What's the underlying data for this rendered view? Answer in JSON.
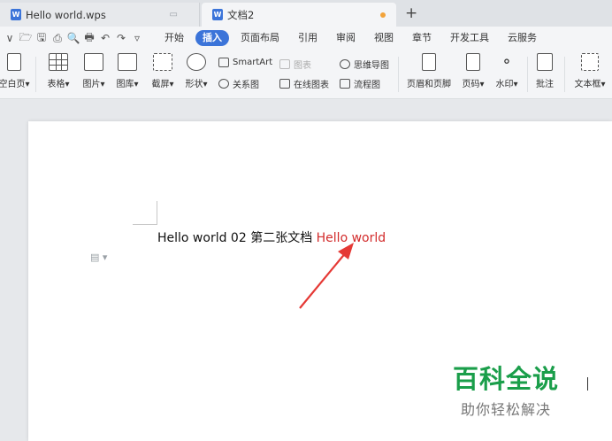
{
  "tabs": [
    {
      "label": "Hello world.wps"
    },
    {
      "label": "文档2"
    }
  ],
  "new_tab": "+",
  "quick_access": [
    "∨",
    "🗁",
    "🖫",
    "⎙",
    "🔍",
    "🖶",
    "↶",
    "↷",
    "▿"
  ],
  "menus": [
    "开始",
    "插入",
    "页面布局",
    "引用",
    "审阅",
    "视图",
    "章节",
    "开发工具",
    "云服务"
  ],
  "active_menu": "插入",
  "ribbon": {
    "blank_page": "空白页",
    "table": "表格",
    "image": "图片",
    "gallery": "图库",
    "screenshot": "截屏",
    "shape": "形状",
    "smartart": "SmartArt",
    "chart": "图表",
    "relation": "关系图",
    "online_chart": "在线图表",
    "mindmap": "思维导图",
    "flowchart": "流程图",
    "header_footer": "页眉和页脚",
    "page_number": "页码",
    "watermark": "水印",
    "comment": "批注",
    "textbox": "文本框"
  },
  "document": {
    "text_main": "Hello world 02 第二张文档 ",
    "text_red": "Hello world"
  },
  "watermark": {
    "title": "百科全说",
    "subtitle": "助你轻松解决"
  },
  "colors": {
    "accent": "#3b74d9",
    "highlight_text": "#d22b2b",
    "arrow": "#e53935",
    "watermark_green": "#1a9e4a",
    "unsaved_dot": "#f2a33a"
  }
}
